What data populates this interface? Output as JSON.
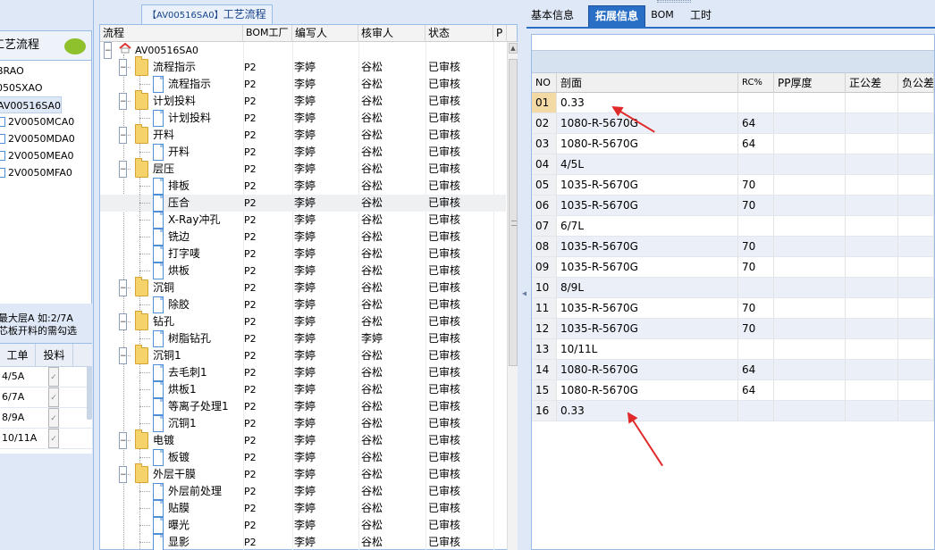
{
  "left": {
    "workflow_title": "工艺流程",
    "items": [
      {
        "label": "BRAO",
        "selected": false,
        "icon": false
      },
      {
        "label": "050SXAO",
        "selected": false,
        "icon": false
      },
      {
        "label": "AV00516SA0",
        "selected": true,
        "icon": false
      },
      {
        "label": "2V0050MCA0",
        "selected": false,
        "icon": true
      },
      {
        "label": "2V0050MDA0",
        "selected": false,
        "icon": true
      },
      {
        "label": "2V0050MEA0",
        "selected": false,
        "icon": true
      },
      {
        "label": "2V0050MFA0",
        "selected": false,
        "icon": true
      }
    ],
    "hint_line1": "最大层A 如:2/7A",
    "hint_line2": "芯板开料的需勾选",
    "grid_headers": {
      "col1": "工单",
      "col2": "投料"
    },
    "grid_rows": [
      {
        "label": "4/5A",
        "checked": true
      },
      {
        "label": "6/7A",
        "checked": true
      },
      {
        "label": "8/9A",
        "checked": true
      },
      {
        "label": "10/11A",
        "checked": true
      }
    ]
  },
  "middle": {
    "panel_title_code": "【AV00516SA0】",
    "panel_title_text": "工艺流程",
    "headers": {
      "flow": "流程",
      "bom": "BOM工厂",
      "writer": "编写人",
      "reviewer": "核审人",
      "status": "状态",
      "p": "P"
    },
    "root": "AV00516SA0",
    "rows": [
      {
        "label": "流程指示",
        "type": "folder",
        "bom": "P2",
        "writer": "李婷",
        "reviewer": "谷松",
        "status": "已审核"
      },
      {
        "label": "流程指示",
        "type": "doc",
        "bom": "P2",
        "writer": "李婷",
        "reviewer": "谷松",
        "status": "已审核"
      },
      {
        "label": "计划投料",
        "type": "folder",
        "bom": "P2",
        "writer": "李婷",
        "reviewer": "谷松",
        "status": "已审核"
      },
      {
        "label": "计划投料",
        "type": "doc",
        "bom": "P2",
        "writer": "李婷",
        "reviewer": "谷松",
        "status": "已审核"
      },
      {
        "label": "开料",
        "type": "folder",
        "bom": "P2",
        "writer": "李婷",
        "reviewer": "谷松",
        "status": "已审核"
      },
      {
        "label": "开料",
        "type": "doc",
        "bom": "P2",
        "writer": "李婷",
        "reviewer": "谷松",
        "status": "已审核"
      },
      {
        "label": "层压",
        "type": "folder",
        "bom": "P2",
        "writer": "李婷",
        "reviewer": "谷松",
        "status": "已审核"
      },
      {
        "label": "排板",
        "type": "doc",
        "bom": "P2",
        "writer": "李婷",
        "reviewer": "谷松",
        "status": "已审核"
      },
      {
        "label": "压合",
        "type": "doc",
        "bom": "P2",
        "writer": "李婷",
        "reviewer": "谷松",
        "status": "已审核",
        "selected": true
      },
      {
        "label": "X-Ray冲孔",
        "type": "doc",
        "bom": "P2",
        "writer": "李婷",
        "reviewer": "谷松",
        "status": "已审核"
      },
      {
        "label": "铣边",
        "type": "doc",
        "bom": "P2",
        "writer": "李婷",
        "reviewer": "谷松",
        "status": "已审核"
      },
      {
        "label": "打字唛",
        "type": "doc",
        "bom": "P2",
        "writer": "李婷",
        "reviewer": "谷松",
        "status": "已审核"
      },
      {
        "label": "烘板",
        "type": "doc",
        "bom": "P2",
        "writer": "李婷",
        "reviewer": "谷松",
        "status": "已审核"
      },
      {
        "label": "沉铜",
        "type": "folder",
        "bom": "P2",
        "writer": "李婷",
        "reviewer": "谷松",
        "status": "已审核"
      },
      {
        "label": "除胶",
        "type": "doc",
        "bom": "P2",
        "writer": "李婷",
        "reviewer": "谷松",
        "status": "已审核"
      },
      {
        "label": "钻孔",
        "type": "folder",
        "bom": "P2",
        "writer": "李婷",
        "reviewer": "谷松",
        "status": "已审核"
      },
      {
        "label": "树脂钻孔",
        "type": "doc",
        "bom": "P2",
        "writer": "李婷",
        "reviewer": "李婷",
        "status": "已审核"
      },
      {
        "label": "沉铜1",
        "type": "folder",
        "bom": "P2",
        "writer": "李婷",
        "reviewer": "谷松",
        "status": "已审核"
      },
      {
        "label": "去毛刺1",
        "type": "doc",
        "bom": "P2",
        "writer": "李婷",
        "reviewer": "谷松",
        "status": "已审核"
      },
      {
        "label": "烘板1",
        "type": "doc",
        "bom": "P2",
        "writer": "李婷",
        "reviewer": "谷松",
        "status": "已审核"
      },
      {
        "label": "等离子处理1",
        "type": "doc",
        "bom": "P2",
        "writer": "李婷",
        "reviewer": "谷松",
        "status": "已审核"
      },
      {
        "label": "沉铜1",
        "type": "doc",
        "bom": "P2",
        "writer": "李婷",
        "reviewer": "谷松",
        "status": "已审核"
      },
      {
        "label": "电镀",
        "type": "folder",
        "bom": "P2",
        "writer": "李婷",
        "reviewer": "谷松",
        "status": "已审核"
      },
      {
        "label": "板镀",
        "type": "doc",
        "bom": "P2",
        "writer": "李婷",
        "reviewer": "谷松",
        "status": "已审核"
      },
      {
        "label": "外层干膜",
        "type": "folder",
        "bom": "P2",
        "writer": "李婷",
        "reviewer": "谷松",
        "status": "已审核"
      },
      {
        "label": "外层前处理",
        "type": "doc",
        "bom": "P2",
        "writer": "李婷",
        "reviewer": "谷松",
        "status": "已审核"
      },
      {
        "label": "贴膜",
        "type": "doc",
        "bom": "P2",
        "writer": "李婷",
        "reviewer": "谷松",
        "status": "已审核"
      },
      {
        "label": "曝光",
        "type": "doc",
        "bom": "P2",
        "writer": "李婷",
        "reviewer": "谷松",
        "status": "已审核"
      },
      {
        "label": "显影",
        "type": "doc",
        "bom": "P2",
        "writer": "李婷",
        "reviewer": "谷松",
        "status": "已审核"
      }
    ]
  },
  "right": {
    "tabs": [
      {
        "label": "基本信息",
        "active": false
      },
      {
        "label": "拓展信息",
        "active": true
      },
      {
        "label": "BOM",
        "active": false
      },
      {
        "label": "工时",
        "active": false
      }
    ],
    "headers": {
      "no": "NO",
      "section": "剖面",
      "rc": "RC%",
      "pp": "PP厚度",
      "plus": "正公差",
      "minus": "负公差"
    },
    "rows": [
      {
        "no": "01",
        "section": "0.33",
        "rc": ""
      },
      {
        "no": "02",
        "section": "1080-R-5670G",
        "rc": "64"
      },
      {
        "no": "03",
        "section": "1080-R-5670G",
        "rc": "64"
      },
      {
        "no": "04",
        "section": "4/5L",
        "rc": ""
      },
      {
        "no": "05",
        "section": "1035-R-5670G",
        "rc": "70"
      },
      {
        "no": "06",
        "section": "1035-R-5670G",
        "rc": "70"
      },
      {
        "no": "07",
        "section": "6/7L",
        "rc": ""
      },
      {
        "no": "08",
        "section": "1035-R-5670G",
        "rc": "70"
      },
      {
        "no": "09",
        "section": "1035-R-5670G",
        "rc": "70"
      },
      {
        "no": "10",
        "section": "8/9L",
        "rc": ""
      },
      {
        "no": "11",
        "section": "1035-R-5670G",
        "rc": "70"
      },
      {
        "no": "12",
        "section": "1035-R-5670G",
        "rc": "70"
      },
      {
        "no": "13",
        "section": "10/11L",
        "rc": ""
      },
      {
        "no": "14",
        "section": "1080-R-5670G",
        "rc": "64"
      },
      {
        "no": "15",
        "section": "1080-R-5670G",
        "rc": "64"
      },
      {
        "no": "16",
        "section": "0.33",
        "rc": ""
      }
    ]
  },
  "colors": {
    "accent": "#2a6fc6",
    "annotation_arrow": "#e02a2a",
    "panel_bg": "#dfe8f6"
  }
}
